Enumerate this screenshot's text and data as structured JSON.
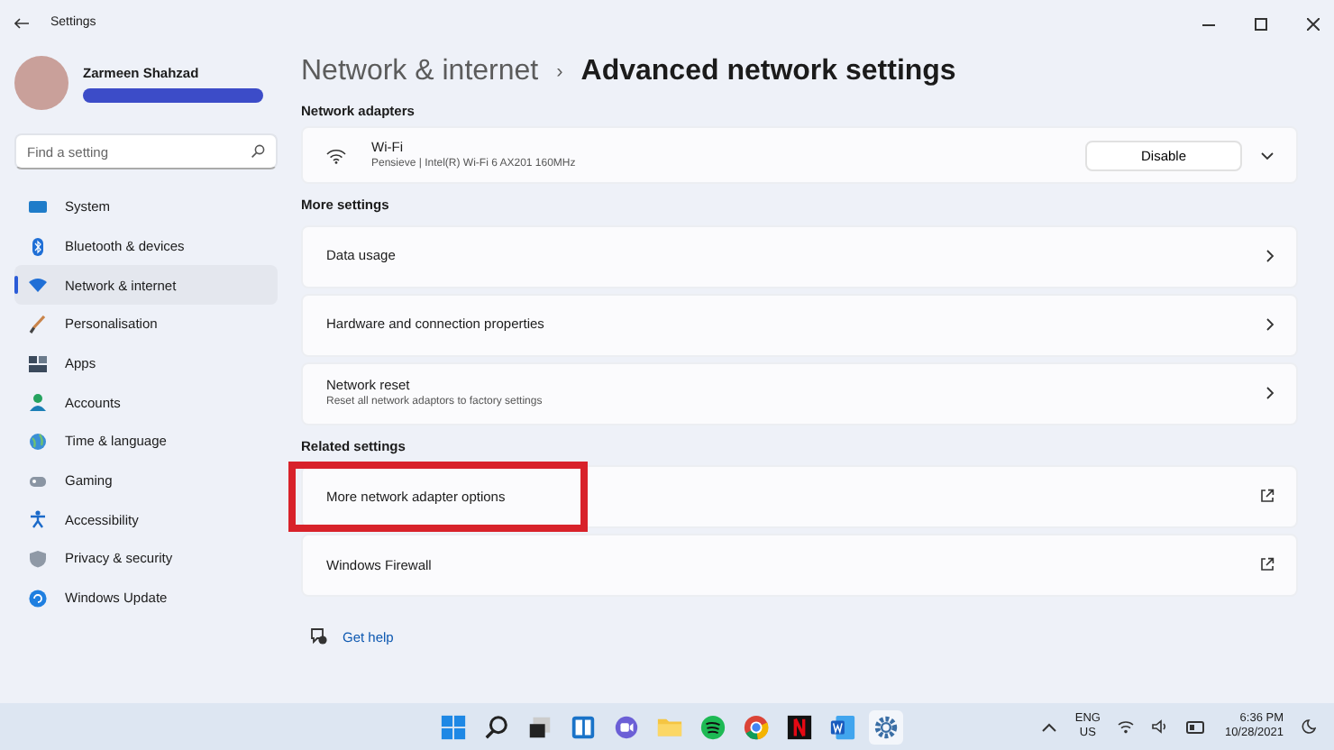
{
  "window": {
    "title": "Settings"
  },
  "profile": {
    "name": "Zarmeen Shahzad"
  },
  "search": {
    "placeholder": "Find a setting"
  },
  "sidebar": {
    "items": [
      {
        "label": "System",
        "kind": "system",
        "selected": false
      },
      {
        "label": "Bluetooth & devices",
        "kind": "bluetooth",
        "selected": false
      },
      {
        "label": "Network & internet",
        "kind": "network",
        "selected": true
      },
      {
        "label": "Personalisation",
        "kind": "brush",
        "selected": false
      },
      {
        "label": "Apps",
        "kind": "apps",
        "selected": false
      },
      {
        "label": "Accounts",
        "kind": "accounts",
        "selected": false
      },
      {
        "label": "Time & language",
        "kind": "globe",
        "selected": false
      },
      {
        "label": "Gaming",
        "kind": "gaming",
        "selected": false
      },
      {
        "label": "Accessibility",
        "kind": "accessibility",
        "selected": false
      },
      {
        "label": "Privacy & security",
        "kind": "shield",
        "selected": false
      },
      {
        "label": "Windows Update",
        "kind": "update",
        "selected": false
      }
    ]
  },
  "breadcrumb": {
    "parent": "Network & internet",
    "separator": "›",
    "current": "Advanced network settings"
  },
  "sections": [
    {
      "heading": "Network adapters",
      "rows": [
        {
          "kind": "adapter",
          "title": "Wi-Fi",
          "subtitle": "Pensieve | Intel(R) Wi-Fi 6 AX201 160MHz",
          "button": "Disable",
          "highlighted": false
        }
      ]
    },
    {
      "heading": "More settings",
      "rows": [
        {
          "kind": "chevron",
          "title": "Data usage",
          "highlighted": false
        },
        {
          "kind": "chevron",
          "title": "Hardware and connection properties",
          "highlighted": false
        },
        {
          "kind": "chevron",
          "title": "Network reset",
          "subtitle": "Reset all network adaptors to factory settings",
          "highlighted": false
        }
      ]
    },
    {
      "heading": "Related settings",
      "rows": [
        {
          "kind": "external",
          "title": "More network adapter options",
          "highlighted": true
        },
        {
          "kind": "external",
          "title": "Windows Firewall",
          "highlighted": false
        }
      ]
    }
  ],
  "help": {
    "label": "Get help"
  },
  "taskbar": {
    "apps": [
      {
        "kind": "start"
      },
      {
        "kind": "search"
      },
      {
        "kind": "taskview"
      },
      {
        "kind": "widgets"
      },
      {
        "kind": "chat"
      },
      {
        "kind": "folder"
      },
      {
        "kind": "music"
      },
      {
        "kind": "browser"
      },
      {
        "kind": "video"
      },
      {
        "kind": "word"
      },
      {
        "kind": "settings"
      }
    ],
    "language": "ENG",
    "region": "US",
    "time": "6:36 PM",
    "date": "10/28/2021"
  }
}
